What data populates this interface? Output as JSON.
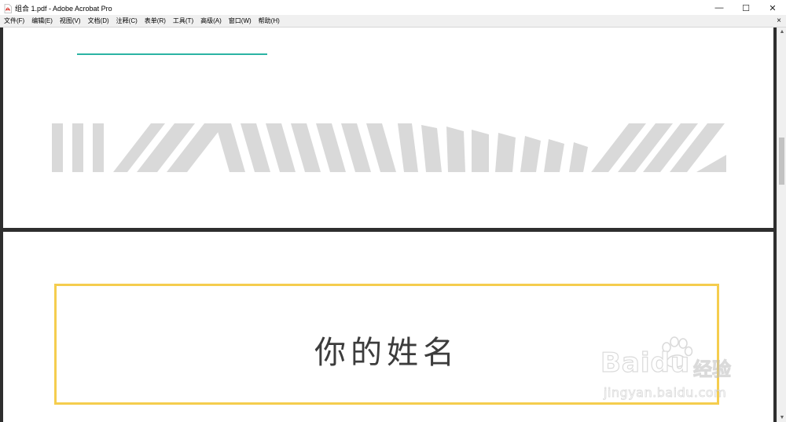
{
  "window": {
    "title": "组合 1.pdf - Adobe Acrobat Pro",
    "minimize_glyph": "—",
    "maximize_glyph": "☐",
    "close_glyph": "✕"
  },
  "menu": {
    "items": [
      "文件(F)",
      "编辑(E)",
      "视图(V)",
      "文档(D)",
      "注释(C)",
      "表单(R)",
      "工具(T)",
      "高级(A)",
      "窗口(W)",
      "帮助(H)"
    ],
    "close_glyph": "×"
  },
  "document": {
    "name_placeholder": "你的姓名",
    "accent_line_color": "#2bb3a3",
    "stripe_color": "#d9d9d9",
    "frame_color": "#f5cd4e"
  },
  "scrollbar": {
    "up_glyph": "▲",
    "down_glyph": "▼"
  },
  "watermark": {
    "logo_text": "Baidu",
    "brand_text": "经验",
    "url_text": "jingyan.baidu.com"
  }
}
